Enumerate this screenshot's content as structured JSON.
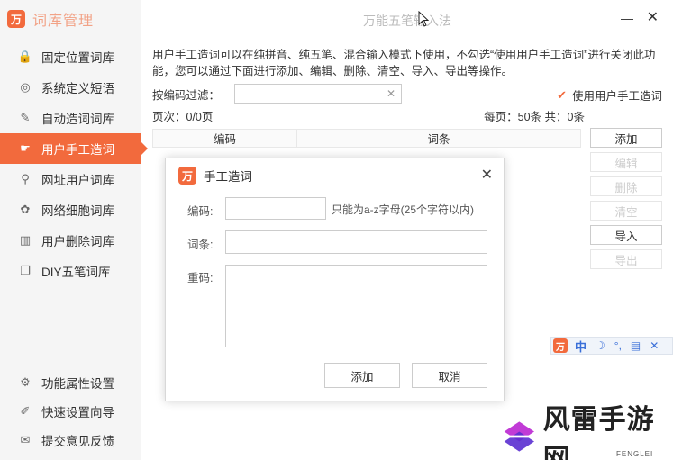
{
  "sidebar": {
    "app_title": "词库管理",
    "items": [
      {
        "label": "固定位置词库",
        "icon": "lock-icon",
        "glyph": "🔒"
      },
      {
        "label": "系统定义短语",
        "icon": "target-icon",
        "glyph": "◎"
      },
      {
        "label": "自动造词词库",
        "icon": "edit-icon",
        "glyph": "✎"
      },
      {
        "label": "用户手工造词",
        "icon": "hand-icon",
        "glyph": "☛"
      },
      {
        "label": "网址用户词库",
        "icon": "link-icon",
        "glyph": "⚲"
      },
      {
        "label": "网络细胞词库",
        "icon": "cells-icon",
        "glyph": "✿"
      },
      {
        "label": "用户删除词库",
        "icon": "trash-icon",
        "glyph": "▥"
      },
      {
        "label": "DIY五笔词库",
        "icon": "pages-icon",
        "glyph": "❐"
      }
    ],
    "active_index": 3,
    "bottom_items": [
      {
        "label": "功能属性设置",
        "icon": "gear-icon",
        "glyph": "⚙"
      },
      {
        "label": "快速设置向导",
        "icon": "wizard-icon",
        "glyph": "✐"
      },
      {
        "label": "提交意见反馈",
        "icon": "feedback-icon",
        "glyph": "✉"
      }
    ]
  },
  "window": {
    "title": "万能五笔输入法",
    "minimize": "—",
    "close": "✕"
  },
  "main": {
    "description": "用户手工造词可以在纯拼音、纯五笔、混合输入模式下使用，不勾选“使用用户手工造词”进行关闭此功能，您可以通过下面进行添加、编辑、删除、清空、导入、导出等操作。",
    "filter_label": "按编码过滤：",
    "filter_value": "",
    "filter_clear": "✕",
    "use_manual_label": "使用用户手工造词",
    "use_manual_checked": true,
    "page_info": "页次：0/0页",
    "per_page_info": "每页：50条 共：0条",
    "table_headers": [
      "编码",
      "词条"
    ],
    "buttons": [
      {
        "label": "添加",
        "enabled": true
      },
      {
        "label": "编辑",
        "enabled": false
      },
      {
        "label": "删除",
        "enabled": false
      },
      {
        "label": "清空",
        "enabled": false
      },
      {
        "label": "导入",
        "enabled": true
      },
      {
        "label": "导出",
        "enabled": false
      }
    ]
  },
  "dialog": {
    "title": "手工造词",
    "close": "✕",
    "code_label": "编码:",
    "code_value": "",
    "code_hint": "只能为a-z字母(25个字符以内)",
    "word_label": "词条:",
    "word_value": "",
    "dup_label": "重码:",
    "dup_value": "",
    "add_label": "添加",
    "cancel_label": "取消"
  },
  "ime_toolbar": {
    "mode": "中",
    "icons": [
      "moon-icon",
      "punctuation-icon",
      "keyboard-icon",
      "tools-icon"
    ]
  },
  "watermark": {
    "text": "风雷手游网",
    "sub": "FENGLEI"
  },
  "colors": {
    "accent": "#f26a3d",
    "ime_blue": "#3a6fd8"
  }
}
